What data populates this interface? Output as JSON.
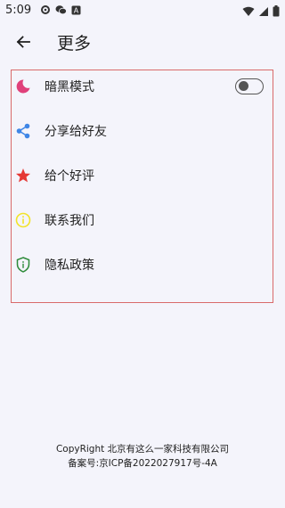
{
  "status_bar": {
    "time": "5:09",
    "left_icons": [
      "gear-icon",
      "wechat-icon",
      "app-notification-icon"
    ],
    "right_icons": [
      "wifi-icon",
      "signal-icon",
      "battery-icon"
    ]
  },
  "app_bar": {
    "back_icon": "arrow-left-icon",
    "title": "更多"
  },
  "menu": {
    "items": [
      {
        "label": "暗黑模式",
        "icon": "moon-icon",
        "icon_color": "#e0407a",
        "has_toggle": true,
        "toggle_on": false
      },
      {
        "label": "分享给好友",
        "icon": "share-icon",
        "icon_color": "#3f86e6"
      },
      {
        "label": "给个好评",
        "icon": "star-icon",
        "icon_color": "#e53935"
      },
      {
        "label": "联系我们",
        "icon": "info-icon",
        "icon_color": "#f2e32a"
      },
      {
        "label": "隐私政策",
        "icon": "shield-icon",
        "icon_color": "#2e8b3a"
      }
    ],
    "border_color": "#d96a6a"
  },
  "footer": {
    "copyright": "CopyRight 北京有这么一家科技有限公司",
    "icp": "备案号:京ICP备2022027917号-4A"
  }
}
